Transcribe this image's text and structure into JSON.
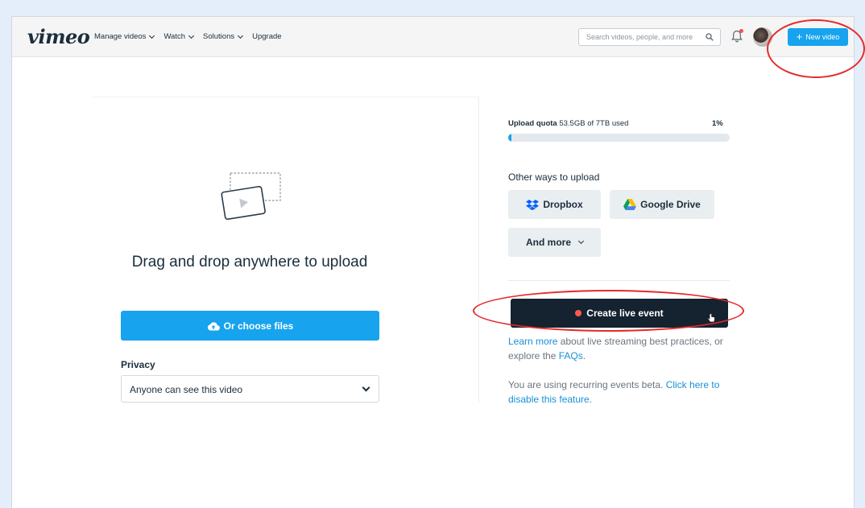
{
  "header": {
    "logo": "vimeo",
    "nav": [
      {
        "label": "Manage videos",
        "dropdown": true
      },
      {
        "label": "Watch",
        "dropdown": true
      },
      {
        "label": "Solutions",
        "dropdown": true
      },
      {
        "label": "Upgrade",
        "dropdown": false
      }
    ],
    "search_placeholder": "Search videos, people, and more",
    "new_video_label": "New video",
    "notification_dot": true
  },
  "upload": {
    "title": "Drag and drop anywhere to upload",
    "choose_label": "Or choose files",
    "privacy_label": "Privacy",
    "privacy_value": "Anyone can see this video"
  },
  "quota": {
    "label": "Upload quota",
    "usage": "53.5GB of 7TB used",
    "percent_text": "1%",
    "percent": 1
  },
  "other_ways": {
    "title": "Other ways to upload",
    "dropbox": "Dropbox",
    "google_drive": "Google Drive",
    "more": "And more"
  },
  "live": {
    "button_label": "Create live event",
    "learn_link": "Learn more",
    "learn_mid": " about live streaming best practices, or explore the ",
    "faq_link": "FAQs",
    "learn_end": ".",
    "recurring_text": "You are using recurring events beta. ",
    "recurring_link": "Click here to disable this feature."
  },
  "colors": {
    "accent": "#17a3ee",
    "dark_button": "#152230",
    "annotation": "#e52a2a",
    "text": "#1a2e3b"
  }
}
